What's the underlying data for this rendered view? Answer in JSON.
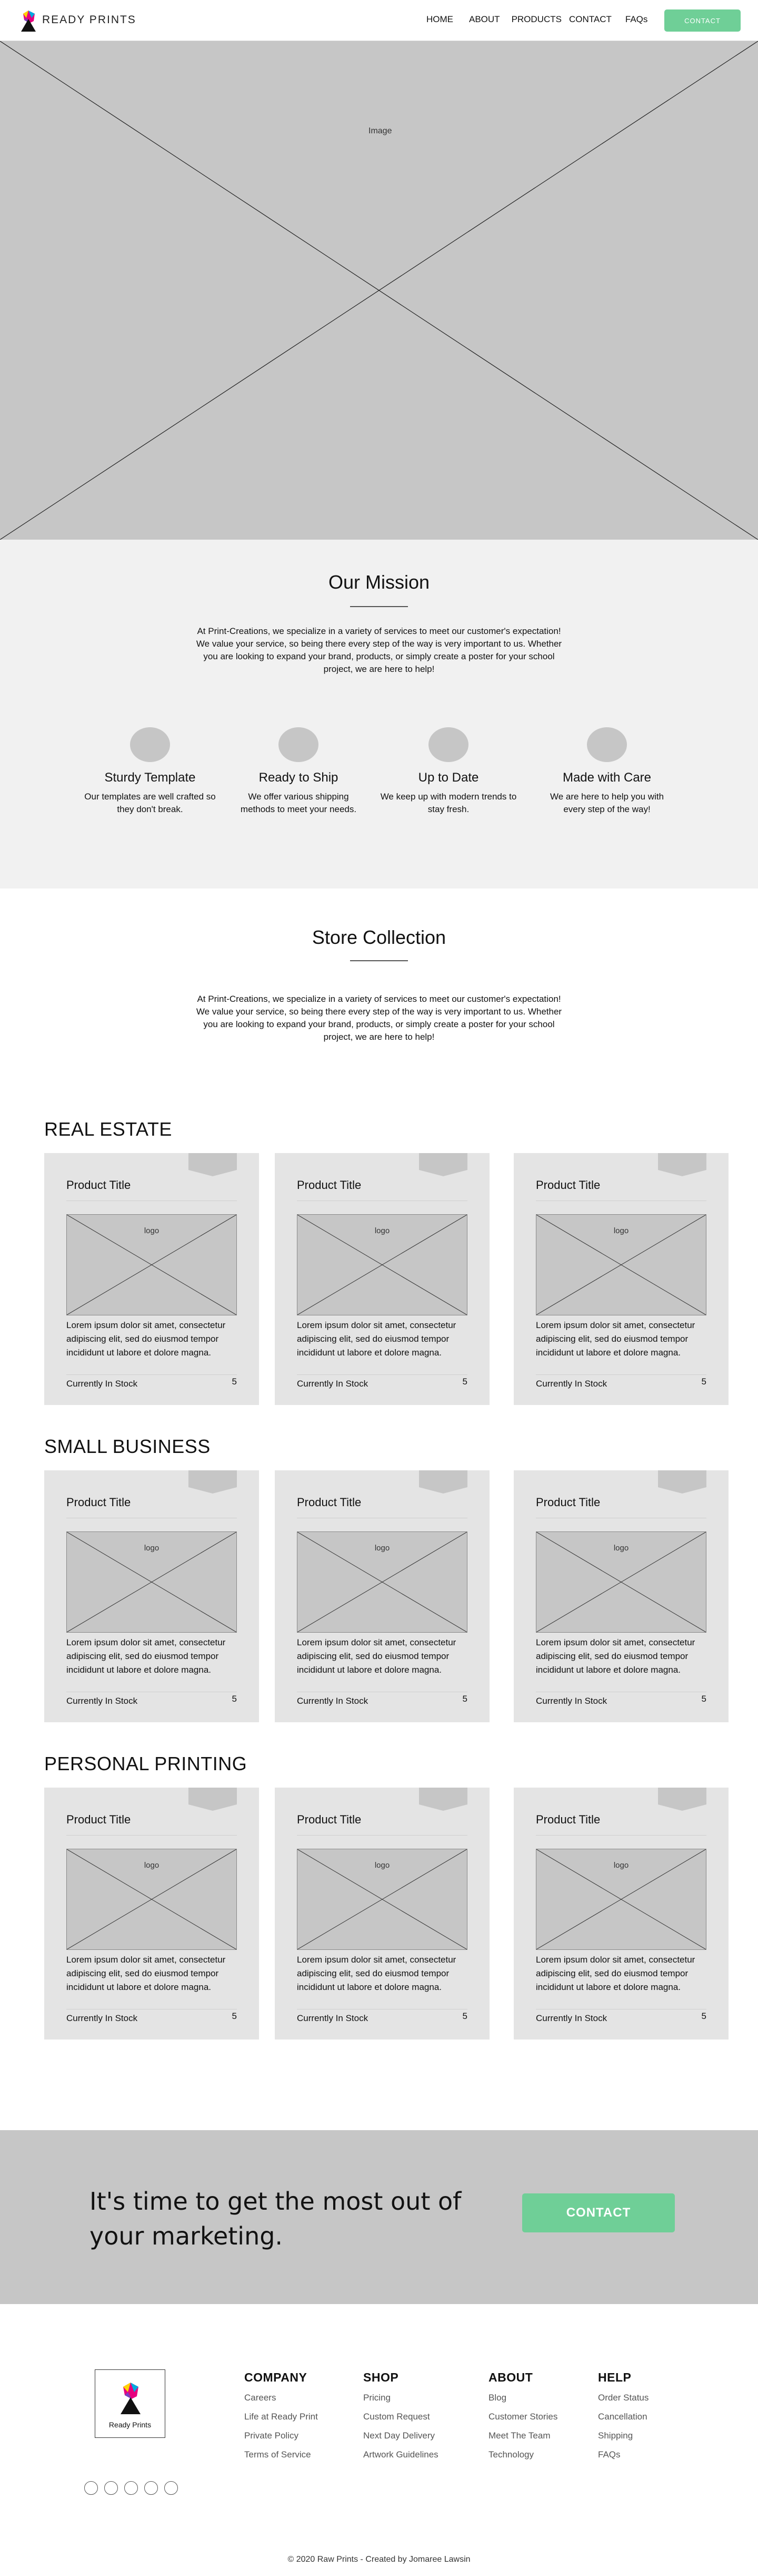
{
  "header": {
    "brand": "READY PRINTS",
    "nav": [
      "HOME",
      "ABOUT",
      "PRODUCTS",
      "CONTACT",
      "FAQs"
    ],
    "cta_label": "CONTACT"
  },
  "hero": {
    "placeholder_label": "Image"
  },
  "mission": {
    "title": "Our Mission",
    "body": "At Print-Creations, we specialize in a variety of services to meet our customer's expectation! We value your service, so being there every step of the way is very important to us. Whether you are looking to expand your brand, products, or simply create a poster for your school project, we are here to help!",
    "features": [
      {
        "title": "Sturdy Template",
        "text": "Our templates are well crafted so they don't break."
      },
      {
        "title": "Ready to Ship",
        "text": "We offer various shipping methods to meet your needs."
      },
      {
        "title": "Up to Date",
        "text": "We keep up with modern trends to stay fresh."
      },
      {
        "title": "Made with Care",
        "text": "We are here to help you with every step of the way!"
      }
    ]
  },
  "collection": {
    "title": "Store Collection",
    "body": "At Print-Creations, we specialize in a variety of services to meet our customer's expectation! We value your service, so being there every step of the way is very important to us. Whether you are looking to expand your brand, products, or simply create a poster for your school project, we are here to help!"
  },
  "categories": [
    {
      "name": "REAL ESTATE"
    },
    {
      "name": "SMALL BUSINESS"
    },
    {
      "name": "PERSONAL PRINTING"
    }
  ],
  "card": {
    "title": "Product Title",
    "image_label": "logo",
    "description": "Lorem ipsum dolor sit amet, consectetur adipiscing elit, sed do eiusmod tempor incididunt ut labore et dolore magna.",
    "stock_label": "Currently In Stock",
    "count": "5"
  },
  "cta": {
    "heading": "It's time to get the most out of your marketing.",
    "button_label": "CONTACT"
  },
  "footer": {
    "logo_text": "Ready Prints",
    "columns": [
      {
        "heading": "COMPANY",
        "links": [
          "Careers",
          "Life at Ready Print",
          "Private Policy",
          "Terms of Service"
        ]
      },
      {
        "heading": "SHOP",
        "links": [
          "Pricing",
          "Custom Request",
          "Next Day Delivery",
          "Artwork Guidelines"
        ]
      },
      {
        "heading": "ABOUT",
        "links": [
          "Blog",
          "Customer Stories",
          "Meet The Team",
          "Technology"
        ]
      },
      {
        "heading": "HELP",
        "links": [
          "Order Status",
          "Cancellation",
          "Shipping",
          "FAQs"
        ]
      }
    ],
    "social_icons": [
      "social-icon-1",
      "social-icon-2",
      "social-icon-3",
      "social-icon-4",
      "social-icon-5"
    ],
    "copyright": "© 2020 Raw Prints - Created by Jomaree Lawsin"
  },
  "colors": {
    "accent": "#6fcf97",
    "placeholder": "#c6c6c6",
    "section_bg": "#f1f1f1",
    "card_bg": "#e4e4e4"
  }
}
